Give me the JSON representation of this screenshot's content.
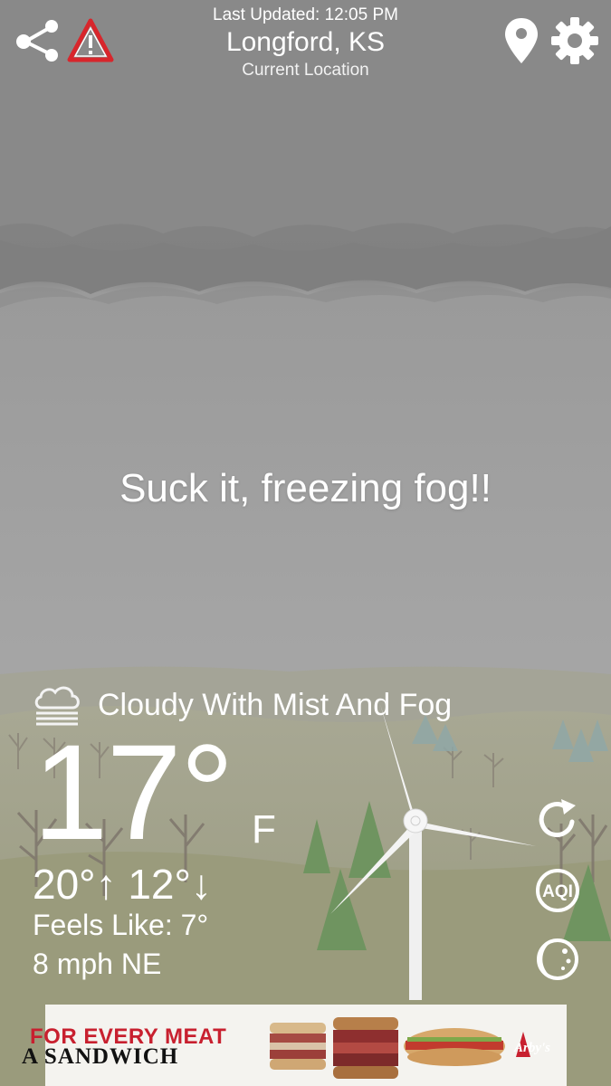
{
  "header": {
    "last_updated": "Last Updated: 12:05 PM",
    "location": "Longford, KS",
    "location_sub": "Current Location"
  },
  "message": "Suck it, freezing fog!!",
  "weather": {
    "condition": "Cloudy With Mist And Fog",
    "condition_icon": "cloud-fog-icon",
    "temperature": "17°",
    "unit": "F",
    "high": "20°",
    "high_arrow": "↑",
    "low": "12°",
    "low_arrow": "↓",
    "feels_like": "Feels Like: 7°",
    "wind": "8 mph NE"
  },
  "side_actions": {
    "refresh_icon": "refresh-icon",
    "aqi_label": "AQI",
    "moon_icon": "moon-phase-icon"
  },
  "toolbar_icons": [
    "share-icon",
    "alert-icon",
    "location-pin-icon",
    "gear-icon"
  ],
  "ad": {
    "line1": "FOR EVERY MEAT",
    "line2": "A SANDWICH",
    "brand": "Arby's"
  },
  "colors": {
    "sky_top": "#8c8c8c",
    "fog": "#a9a9a9",
    "hills": "#9c9d82",
    "tree_green": "#6f9460",
    "ad_red": "#c8202f"
  }
}
